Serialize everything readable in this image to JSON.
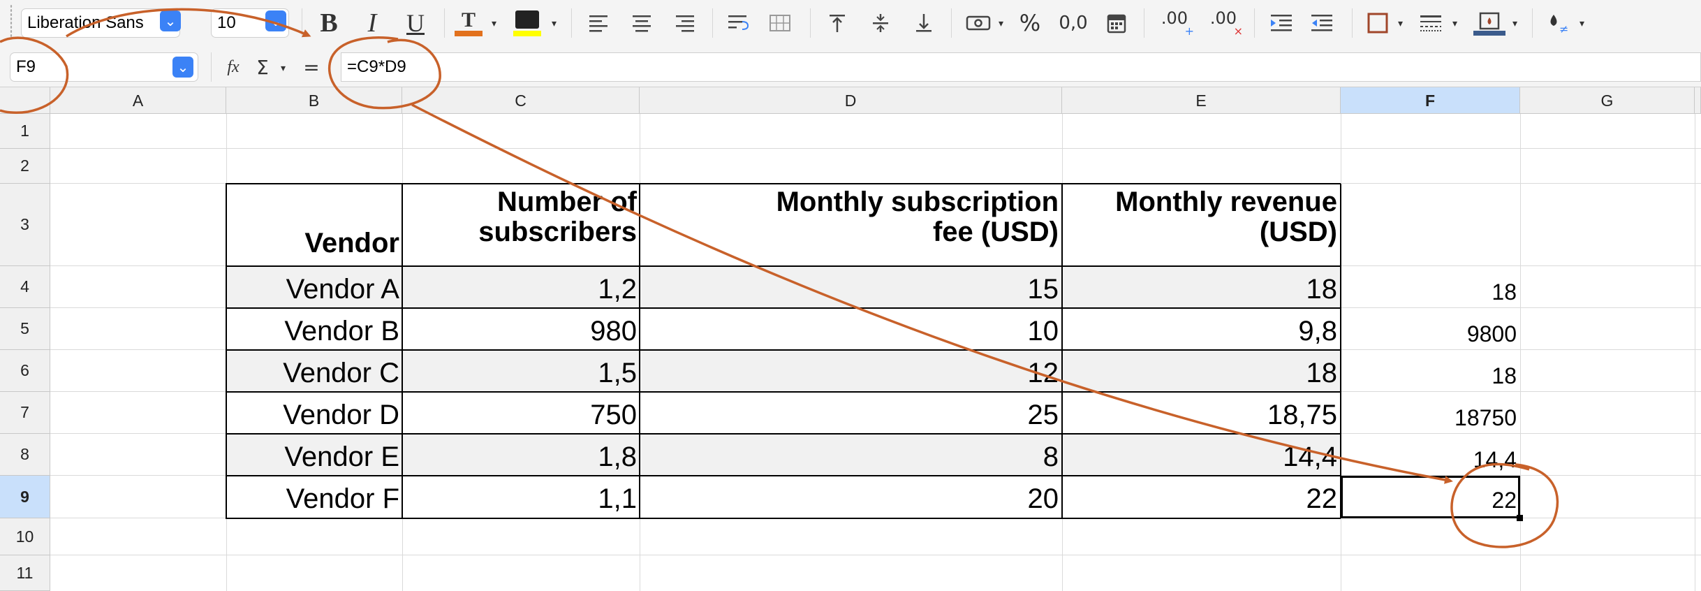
{
  "toolbar": {
    "font_name": "Liberation Sans",
    "font_size": "10",
    "buttons": [
      {
        "name": "bold-button",
        "glyph": "B"
      },
      {
        "name": "italic-button",
        "glyph": "I"
      },
      {
        "name": "underline-button",
        "glyph": "U"
      }
    ],
    "font_color_accent": "#e2711d",
    "highlight_color_accent": "#ffff00",
    "border_color_accent": "#3b5b8c",
    "percent_glyph": "%",
    "decimal_glyph": "0,0",
    "add_decimal_glyph": ".00",
    "remove_decimal_glyph": ".00"
  },
  "formula_bar": {
    "name_box": "F9",
    "function_glyph": "fx",
    "sum_glyph": "Σ",
    "equals_glyph": "=",
    "formula": "=C9*D9"
  },
  "grid": {
    "columns": [
      "A",
      "B",
      "C",
      "D",
      "E",
      "F",
      "G"
    ],
    "selected_column": "F",
    "rows": [
      "1",
      "2",
      "3",
      "4",
      "5",
      "6",
      "7",
      "8",
      "9",
      "10",
      "11"
    ],
    "selected_row": "9",
    "selected_cell": "F9"
  },
  "table": {
    "headers": {
      "vendor": "Vendor",
      "subscribers_1": "Number of",
      "subscribers_2": "subscribers",
      "fee_1": "Monthly subscription",
      "fee_2": "fee (USD)",
      "revenue_1": "Monthly revenue",
      "revenue_2": "(USD)"
    },
    "rows": [
      {
        "vendor": "Vendor A",
        "subscribers": "1,2",
        "fee": "15",
        "revenue": "18",
        "f": "18"
      },
      {
        "vendor": "Vendor B",
        "subscribers": "980",
        "fee": "10",
        "revenue": "9,8",
        "f": "9800"
      },
      {
        "vendor": "Vendor C",
        "subscribers": "1,5",
        "fee": "12",
        "revenue": "18",
        "f": "18"
      },
      {
        "vendor": "Vendor D",
        "subscribers": "750",
        "fee": "25",
        "revenue": "18,75",
        "f": "18750"
      },
      {
        "vendor": "Vendor E",
        "subscribers": "1,8",
        "fee": "8",
        "revenue": "14,4",
        "f": "14,4"
      },
      {
        "vendor": "Vendor F",
        "subscribers": "1,1",
        "fee": "20",
        "revenue": "22",
        "f": "22"
      }
    ]
  },
  "annotation_color": "#c8612a"
}
